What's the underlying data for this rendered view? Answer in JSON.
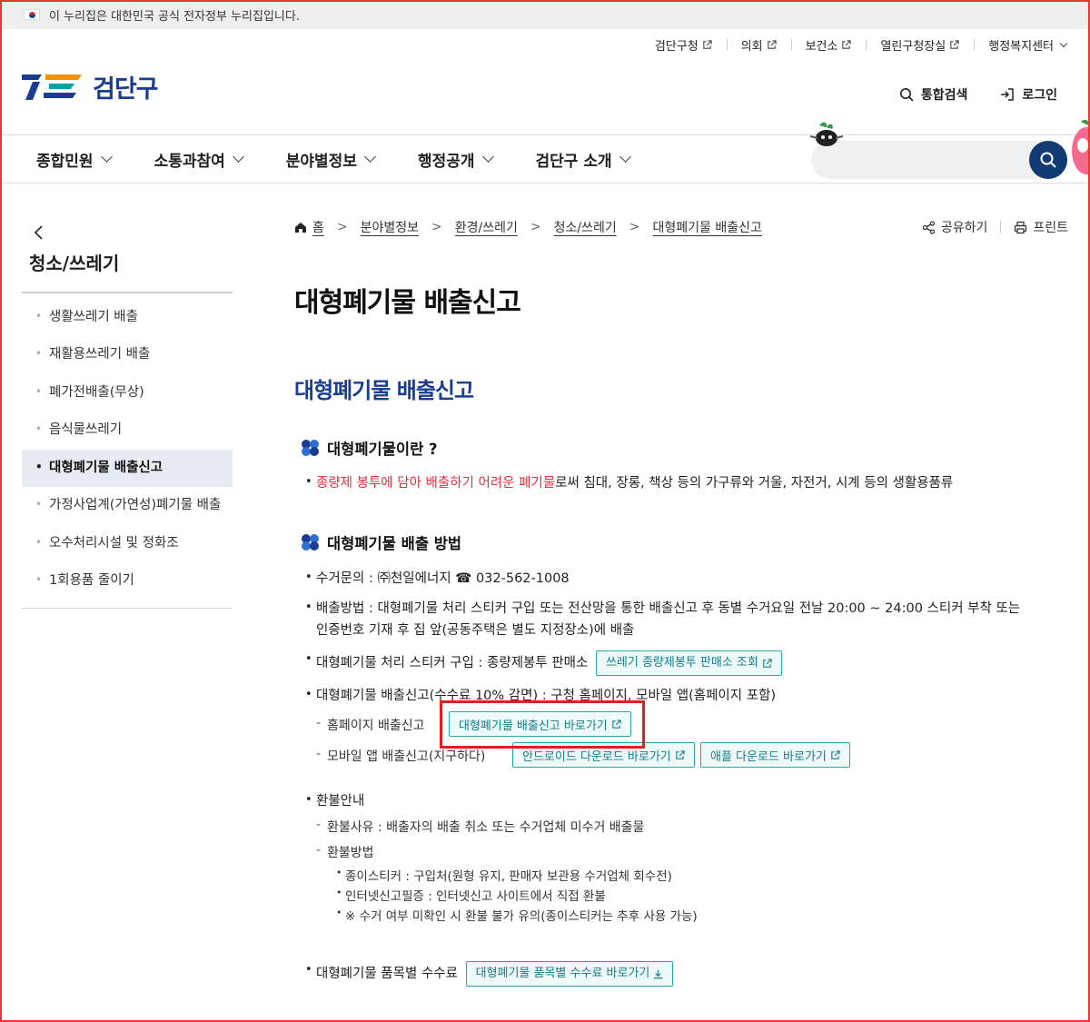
{
  "gov_banner": {
    "text": "이 누리집은 대한민국 공식 전자정부 누리집입니다."
  },
  "util_links": [
    "검단구청",
    "의회",
    "보건소",
    "열린구청장실",
    "행정복지센터"
  ],
  "logo": {
    "text": "검단구"
  },
  "header_buttons": {
    "search": "통합검색",
    "login": "로그인"
  },
  "gnb": [
    "종합민원",
    "소통과참여",
    "분야별정보",
    "행정공개",
    "검단구 소개"
  ],
  "sidebar": {
    "title": "청소/쓰레기",
    "items": [
      "생활쓰레기 배출",
      "재활용쓰레기 배출",
      "폐가전배출(무상)",
      "음식물쓰레기",
      "대형폐기물 배출신고",
      "가정사업계(가연성)폐기물 배출",
      "오수처리시설 및 정화조",
      "1회용품 줄이기"
    ],
    "active": "대형폐기물 배출신고"
  },
  "breadcrumb": [
    "홈",
    "분야별정보",
    "환경/쓰레기",
    "청소/쓰레기",
    "대형폐기물 배출신고"
  ],
  "tools": {
    "share": "공유하기",
    "print": "프린트"
  },
  "page_title": "대형폐기물 배출신고",
  "section_title": "대형폐기물 배출신고",
  "what": {
    "heading": "대형폐기물이란 ?",
    "highlight": "종량제 봉투에 담아 배출하기 어려운 폐기물",
    "rest": "로써 침대, 장롱, 책상 등의 가구류와 거울, 자전거, 시계 등의 생활용품류"
  },
  "method": {
    "heading": "대형폐기물 배출 방법",
    "contact": "수거문의 : ㈜천일에너지 ☎ 032-562-1008",
    "method_line1": "배출방법 : 대형폐기물 처리 스티커 구입 또는 전산망을 통한 배출신고 후 동별 수거요일 전날 20:00 ~ 24:00 스티커 부착 또는",
    "method_line2": "인증번호 기재 후 집 앞(공동주택은 별도 지정장소)에 배출",
    "sticker": "대형폐기물 처리 스티커 구입 : 종량제봉투 판매소",
    "sticker_btn": "쓰레기 종량제봉투 판매소 조회",
    "report": "대형폐기물 배출신고(수수료 10% 감면) : 구청 홈페이지, 모바일 앱(홈페이지 포함)",
    "home_report": "홈페이지 배출신고",
    "home_report_btn": "대형폐기물 배출신고 바로가기",
    "mobile_report": "모바일 앱 배출신고(지구하다)",
    "android_btn": "안드로이드 다운로드 바로가기",
    "apple_btn": "애플 다운로드 바로가기"
  },
  "refund": {
    "title": "환불안내",
    "reason": "환불사유 : 배출자의 배출 취소 또는 수거업체 미수거 배출물",
    "method": "환불방법",
    "m1": "종이스티커 : 구입처(원형 유지, 판매자 보관용 수거업체 회수전)",
    "m2": "인터넷신고필증 : 인터넷신고 사이트에서 직접 환불",
    "m3": "※ 수거 여부 미확인 시 환불 불가 유의(종이스티커는 추후 사용 가능)"
  },
  "fee": {
    "label": "대형폐기물 품목별 수수료",
    "btn": "대형폐기물 품목별 수수료 바로가기"
  },
  "colors": {
    "brand": "#1b3d8f",
    "teal": "#2aa7a7",
    "highlight_box": "#e21e1e",
    "red_text": "#e0303f"
  }
}
